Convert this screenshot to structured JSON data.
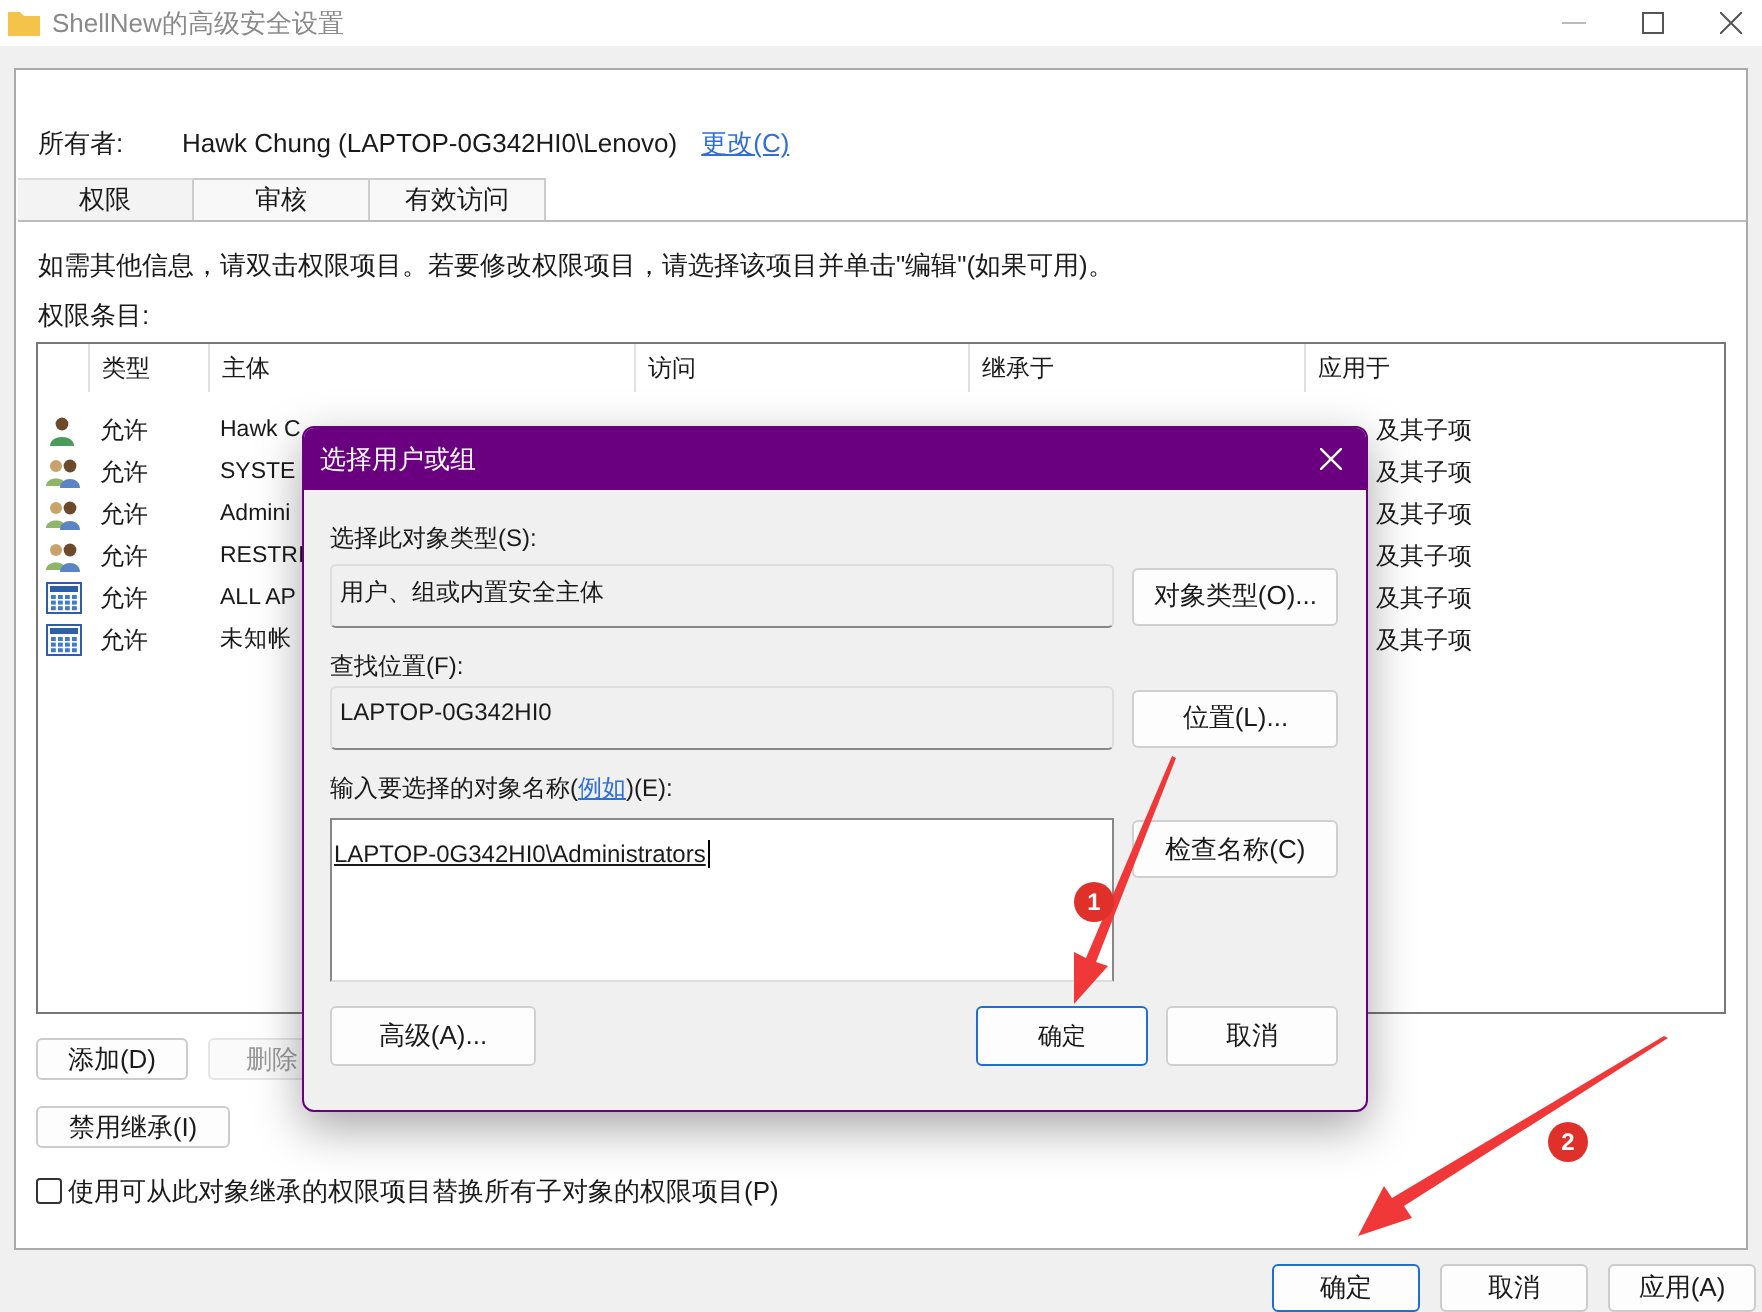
{
  "window": {
    "title": "ShellNew的高级安全设置"
  },
  "owner": {
    "label": "所有者:",
    "value": "Hawk Chung (LAPTOP-0G342HI0\\Lenovo)",
    "link": "更改(C)"
  },
  "tabs": [
    {
      "label": "权限",
      "selected": true
    },
    {
      "label": "审核",
      "selected": false
    },
    {
      "label": "有效访问",
      "selected": false
    }
  ],
  "info": "如需其他信息，请双击权限项目。若要修改权限项目，请选择该项目并单击\"编辑\"(如果可用)。",
  "list_label": "权限条目:",
  "table": {
    "columns": [
      "类型",
      "主体",
      "访问",
      "继承于",
      "应用于"
    ],
    "rows": [
      {
        "kind": "user",
        "type": "允许",
        "principal": "Hawk C",
        "applies": "及其子项"
      },
      {
        "kind": "group",
        "type": "允许",
        "principal": "SYSTE",
        "applies": "及其子项"
      },
      {
        "kind": "group",
        "type": "允许",
        "principal": "Admini",
        "applies": "及其子项"
      },
      {
        "kind": "group",
        "type": "允许",
        "principal": "RESTRI",
        "applies": "及其子项"
      },
      {
        "kind": "app",
        "type": "允许",
        "principal": "ALL AP",
        "applies": "及其子项"
      },
      {
        "kind": "app",
        "type": "允许",
        "principal": "未知帐",
        "applies": "及其子项"
      }
    ]
  },
  "buttons": [
    {
      "label": "添加(D)",
      "disabled": false
    },
    {
      "label": "删除",
      "disabled": true
    }
  ],
  "disable_inheritance": "禁用继承(I)",
  "replace_checkbox": {
    "label": "使用可从此对象继承的权限项目替换所有子对象的权限项目(P)",
    "checked": false
  },
  "footer_buttons": [
    {
      "label": "确定",
      "default": true
    },
    {
      "label": "取消",
      "default": false
    },
    {
      "label": "应用(A)",
      "default": false
    }
  ],
  "dialog": {
    "title": "选择用户或组",
    "type_label": "选择此对象类型(S):",
    "type_value": "用户、组或内置安全主体",
    "type_button": "对象类型(O)...",
    "location_label": "查找位置(F):",
    "location_value": "LAPTOP-0G342HI0",
    "location_button": "位置(L)...",
    "name_label_before": "输入要选择的对象名称(",
    "name_label_link": "例如",
    "name_label_after": ")(E):",
    "name_value": "LAPTOP-0G342HI0\\Administrators",
    "check_button": "检查名称(C)",
    "advanced_button": "高级(A)...",
    "ok_button": "确定",
    "cancel_button": "取消"
  },
  "annotations": [
    {
      "number": "1"
    },
    {
      "number": "2"
    }
  ]
}
